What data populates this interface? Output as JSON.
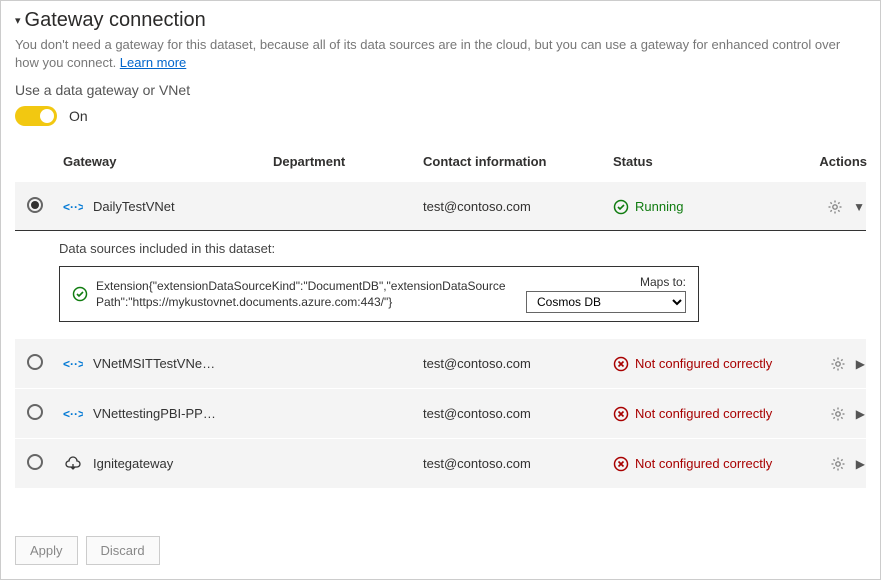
{
  "header": {
    "title": "Gateway connection",
    "description": "You don't need a gateway for this dataset, because all of its data sources are in the cloud, but you can use a gateway for enhanced control over how you connect. ",
    "learn_more": "Learn more",
    "sub_label": "Use a data gateway or VNet",
    "toggle_label": "On"
  },
  "columns": {
    "gateway": "Gateway",
    "department": "Department",
    "contact": "Contact information",
    "status": "Status",
    "actions": "Actions"
  },
  "gateways": [
    {
      "selected": true,
      "icon": "vnet",
      "name": "DailyTestVNet",
      "department": "",
      "contact": "test@contoso.com",
      "status_kind": "ok",
      "status_text": "Running",
      "expanded": true
    },
    {
      "selected": false,
      "icon": "vnet",
      "name": "VNetMSITTestVNe…",
      "department": "",
      "contact": "test@contoso.com",
      "status_kind": "bad",
      "status_text": "Not configured correctly",
      "expanded": false
    },
    {
      "selected": false,
      "icon": "vnet",
      "name": "VNettestingPBI-PP…",
      "department": "",
      "contact": "test@contoso.com",
      "status_kind": "bad",
      "status_text": "Not configured correctly",
      "expanded": false
    },
    {
      "selected": false,
      "icon": "cloud",
      "name": "Ignitegateway",
      "department": "",
      "contact": "test@contoso.com",
      "status_kind": "bad",
      "status_text": "Not configured correctly",
      "expanded": false
    }
  ],
  "expand": {
    "title": "Data sources included in this dataset:",
    "ds_text": "Extension{\"extensionDataSourceKind\":\"DocumentDB\",\"extensionDataSourcePath\":\"https://mykustovnet.documents.azure.com:443/\"}",
    "maps_label": "Maps to:",
    "maps_value": "Cosmos DB"
  },
  "buttons": {
    "apply": "Apply",
    "discard": "Discard"
  }
}
